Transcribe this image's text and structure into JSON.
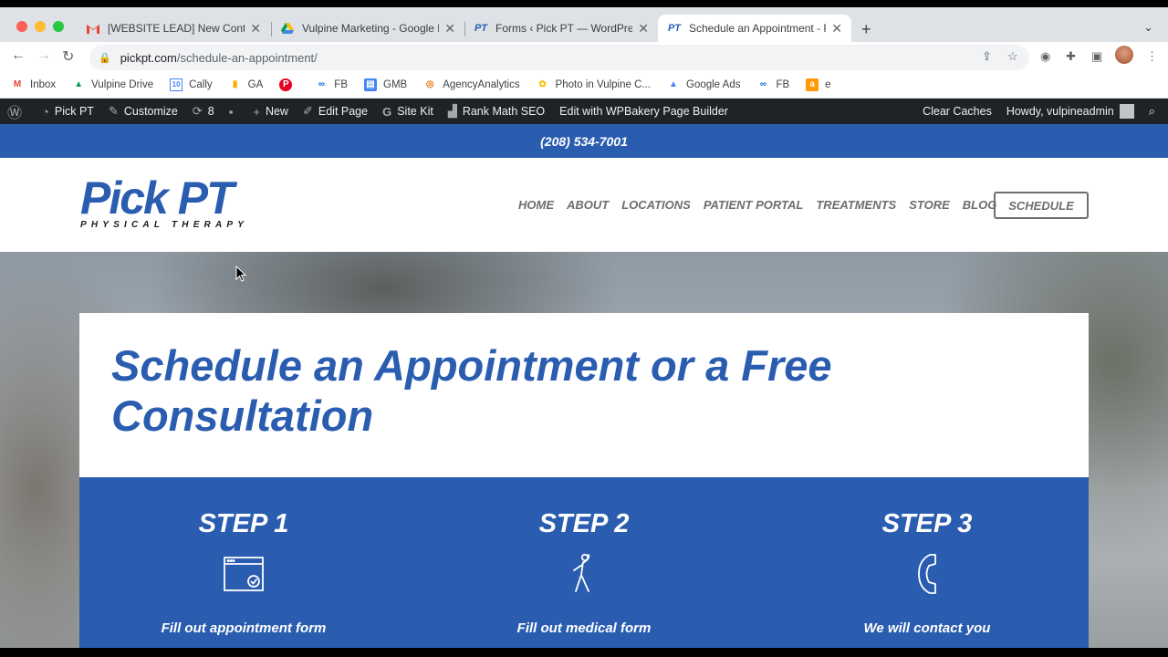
{
  "browser": {
    "tabs": [
      {
        "favicon": "gmail-icon",
        "title": "[WEBSITE LEAD] New Contact",
        "active": false
      },
      {
        "favicon": "google-drive-icon",
        "title": "Vulpine Marketing - Google Dri",
        "active": false
      },
      {
        "favicon": "pt-icon",
        "title": "Forms ‹ Pick PT — WordPress",
        "active": false
      },
      {
        "favicon": "pt-icon",
        "title": "Schedule an Appointment - Pic",
        "active": true
      }
    ],
    "url_domain": "pickpt.com",
    "url_path": "/schedule-an-appointment/",
    "bookmarks": [
      {
        "icon": "gmail-icon",
        "label": "Inbox"
      },
      {
        "icon": "google-drive-icon",
        "label": "Vulpine Drive"
      },
      {
        "icon": "calendar-icon",
        "label": "Cally"
      },
      {
        "icon": "analytics-icon",
        "label": "GA"
      },
      {
        "icon": "pinterest-icon",
        "label": ""
      },
      {
        "icon": "meta-icon",
        "label": "FB"
      },
      {
        "icon": "gmb-icon",
        "label": "GMB"
      },
      {
        "icon": "agencyanalytics-icon",
        "label": "AgencyAnalytics"
      },
      {
        "icon": "google-photos-icon",
        "label": "Photo in Vulpine C..."
      },
      {
        "icon": "google-ads-icon",
        "label": "Google Ads"
      },
      {
        "icon": "meta-icon",
        "label": "FB"
      },
      {
        "icon": "amazon-icon",
        "label": "e"
      }
    ]
  },
  "wp_admin_bar": {
    "items": [
      {
        "icon": "wordpress-icon",
        "label": ""
      },
      {
        "icon": "dashboard-icon",
        "label": "Pick PT"
      },
      {
        "icon": "brush-icon",
        "label": "Customize"
      },
      {
        "icon": "updates-icon",
        "label": "8"
      },
      {
        "icon": "comment-icon",
        "label": ""
      },
      {
        "icon": "plus-icon",
        "label": "New"
      },
      {
        "icon": "pencil-icon",
        "label": "Edit Page"
      },
      {
        "icon": "google-g-icon",
        "label": "Site Kit"
      },
      {
        "icon": "rankmath-icon",
        "label": "Rank Math SEO"
      },
      {
        "icon": "",
        "label": "Edit with WPBakery Page Builder"
      }
    ],
    "clear_caches": "Clear Caches",
    "howdy": "Howdy, vulpineadmin"
  },
  "site": {
    "phone": "(208) 534-7001",
    "logo_main": "Pick PT",
    "logo_sub": "PHYSICAL THERAPY",
    "nav": [
      "HOME",
      "ABOUT",
      "LOCATIONS",
      "PATIENT PORTAL",
      "TREATMENTS",
      "STORE",
      "BLOG"
    ],
    "schedule_button": "SCHEDULE",
    "heading": "Schedule an Appointment or a Free Consultation",
    "steps": [
      {
        "title": "STEP 1",
        "icon": "browser-check-icon",
        "desc": "Fill out appointment form"
      },
      {
        "title": "STEP 2",
        "icon": "person-stretch-icon",
        "desc": "Fill out medical form"
      },
      {
        "title": "STEP 3",
        "icon": "phone-icon",
        "desc": "We will contact you"
      }
    ]
  },
  "colors": {
    "brand_blue": "#2a5db0",
    "nav_gray": "#6d6e71",
    "wp_bar": "#1d2327"
  }
}
